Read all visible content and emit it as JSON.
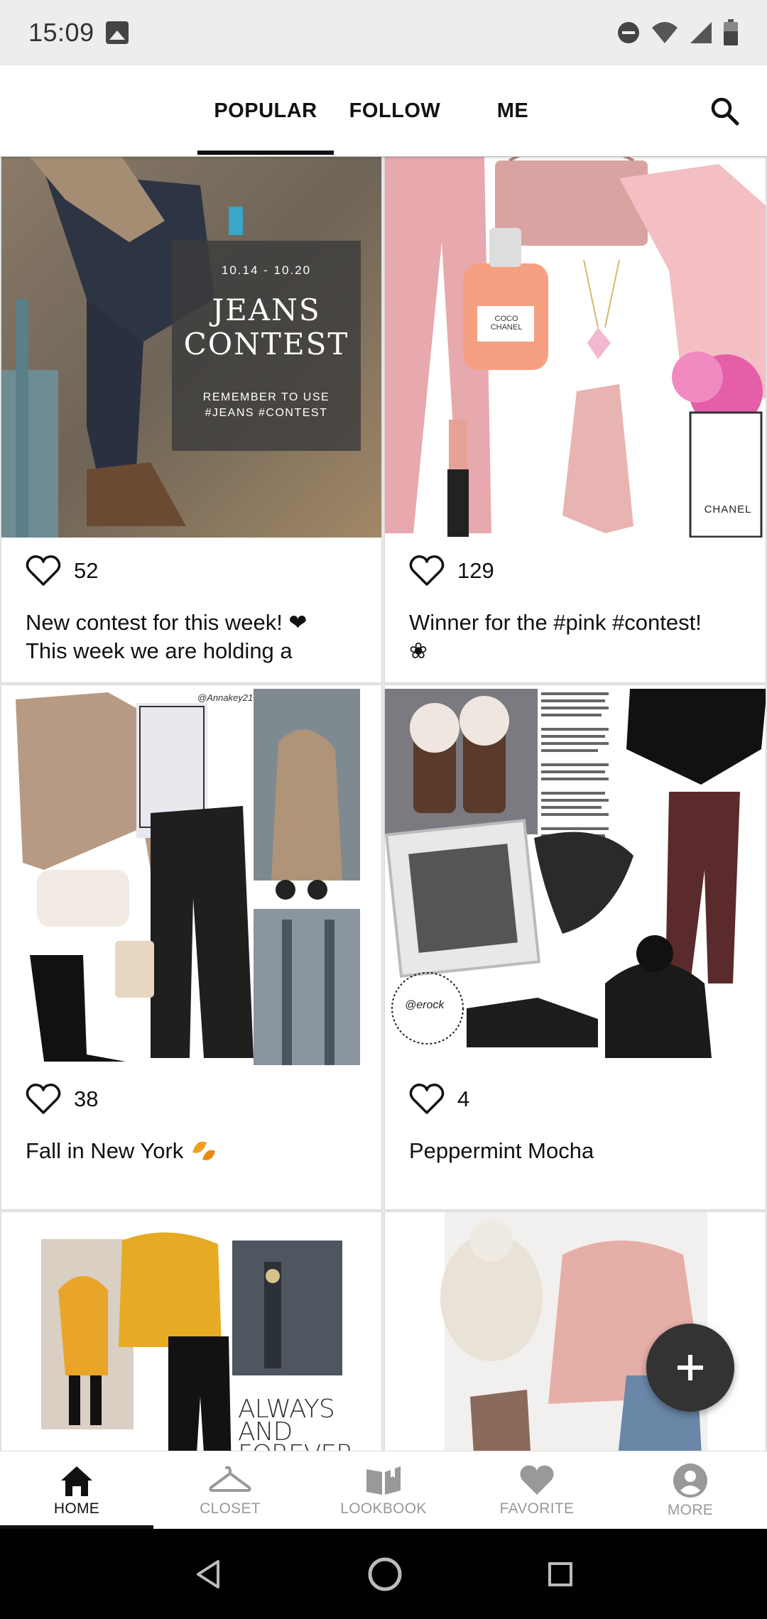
{
  "status_bar": {
    "time": "15:09"
  },
  "tabs": [
    {
      "label": "POPULAR",
      "active": true
    },
    {
      "label": "FOLLOW",
      "active": false
    },
    {
      "label": "ME",
      "active": false
    }
  ],
  "posts": [
    {
      "likes": "52",
      "text": "New contest for this week! ❤\nThis week we are holding a",
      "overlay": {
        "dates": "10.14 - 10.20",
        "title_line1": "JEANS",
        "title_line2": "CONTEST",
        "note_line1": "REMEMBER TO USE",
        "note_line2": "#JEANS #CONTEST"
      }
    },
    {
      "likes": "129",
      "text": "Winner for the #pink #contest!\n❀",
      "image_text": {
        "perfume_brand": "COCO",
        "perfume_sub": "CHANEL",
        "bag_brand": "CHANEL"
      }
    },
    {
      "likes": "38",
      "text": "Fall in New York ",
      "image_text": {
        "watermark": "@Annakey21"
      }
    },
    {
      "likes": "4",
      "text": "Peppermint Mocha",
      "image_text": {
        "stamp": "@erock"
      }
    },
    {
      "image_text": {
        "line1": "ALWAYS",
        "line2": "AND",
        "line3": "FOREVER"
      }
    },
    {
      "image_text": {}
    }
  ],
  "bottom_nav": [
    {
      "label": "HOME",
      "icon": "home-icon",
      "active": true
    },
    {
      "label": "CLOSET",
      "icon": "hanger-icon",
      "active": false
    },
    {
      "label": "LOOKBOOK",
      "icon": "book-icon",
      "active": false
    },
    {
      "label": "FAVORITE",
      "icon": "heart-icon",
      "active": false
    },
    {
      "label": "MORE",
      "icon": "profile-icon",
      "active": false
    }
  ],
  "colors": {
    "accent": "#111111",
    "inactive": "#999999",
    "fab": "#333333",
    "heart_red": "#d81b27",
    "leaf_orange": "#f0a020"
  }
}
